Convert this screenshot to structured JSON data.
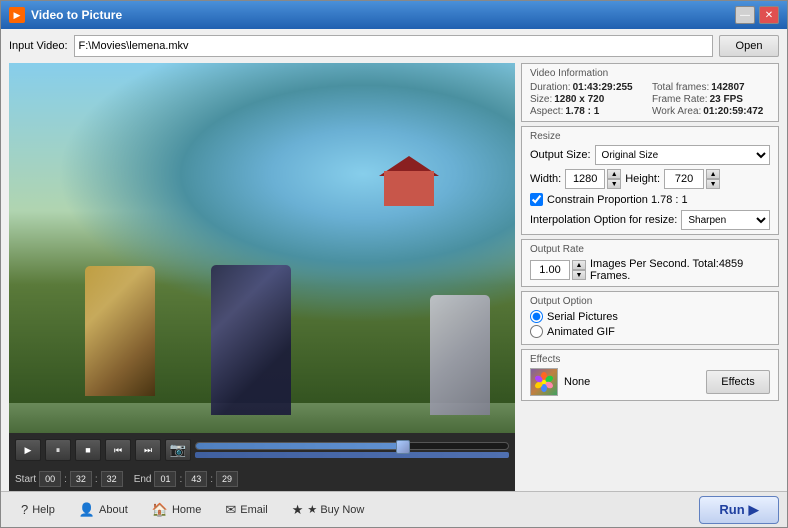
{
  "window": {
    "title": "Video to Picture",
    "icon": "▶"
  },
  "titlebar": {
    "minimize_label": "—",
    "close_label": "✕"
  },
  "input": {
    "label": "Input Video:",
    "value": "F:\\Movies\\lemena.mkv",
    "open_btn": "Open"
  },
  "video_info": {
    "group_title": "Video Information",
    "duration_label": "Duration:",
    "duration_value": "01:43:29:255",
    "total_frames_label": "Total frames:",
    "total_frames_value": "142807",
    "size_label": "Size:",
    "size_value": "1280 x 720",
    "frame_rate_label": "Frame Rate:",
    "frame_rate_value": "23 FPS",
    "aspect_label": "Aspect:",
    "aspect_value": "1.78 : 1",
    "work_area_label": "Work Area:",
    "work_area_value": "01:20:59:472"
  },
  "resize": {
    "group_title": "Resize",
    "output_size_label": "Output Size:",
    "output_size_value": "Original Size",
    "width_label": "Width:",
    "width_value": "1280",
    "height_label": "Height:",
    "height_value": "720",
    "constrain_label": "Constrain Proportion 1.78 : 1",
    "interp_label": "Interpolation Option for resize:",
    "interp_value": "Sharpen"
  },
  "output_rate": {
    "group_title": "Output Rate",
    "rate_value": "1.00",
    "rate_desc": "Images Per Second. Total:4859 Frames."
  },
  "output_option": {
    "group_title": "Output Option",
    "serial_label": "Serial Pictures",
    "animated_label": "Animated GIF"
  },
  "effects": {
    "group_title": "Effects",
    "effect_name": "None",
    "btn_label": "Effects"
  },
  "controls": {
    "play": "▶",
    "pause": "⏸",
    "stop": "■",
    "prev": "⏮",
    "next": "⏭",
    "camera": "📷",
    "start_label": "Start",
    "end_label": "End",
    "start_h": "00",
    "start_m": "32",
    "start_s": "32",
    "end_h": "01",
    "end_m": "43",
    "end_s": "29"
  },
  "bottom_nav": {
    "help": "? Help",
    "about": "About",
    "home": "Home",
    "email": "Email",
    "buy": "★ Buy Now",
    "run_btn": "Run"
  }
}
